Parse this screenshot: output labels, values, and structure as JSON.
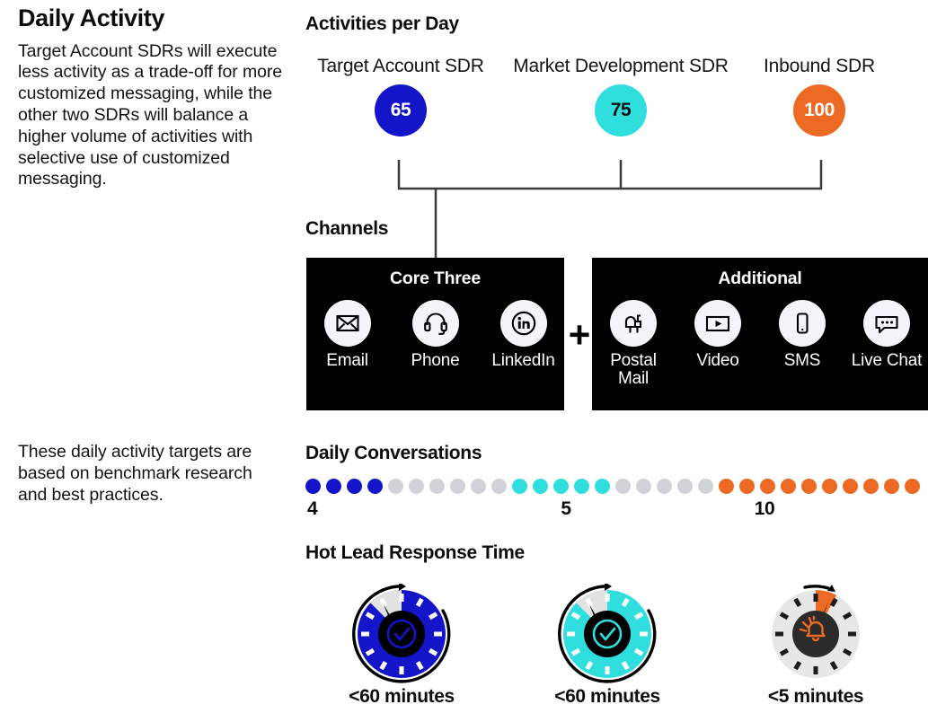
{
  "colors": {
    "blue": "#1414c8",
    "cyan": "#2fdedd",
    "orange": "#ec6a24",
    "gray_dot": "#cfd2d6",
    "black": "#000000",
    "white": "#ffffff",
    "hub_dark": "#1c1c1c",
    "gray_wedge": "#e2e2e2",
    "ring_gray": "#e7e7e7"
  },
  "left": {
    "title": "Daily Activity",
    "lede": "Target Account SDRs will execute less activity as a trade-off for more customized messaging, while the other two SDRs will balance a higher volume of activities with selective use of customized messaging.",
    "note": "These daily activity targets are based on benchmark research and best practices."
  },
  "activities": {
    "heading": "Activities per Day",
    "columns": [
      {
        "name": "Target Account SDR",
        "value": "65",
        "color": "#1414c8",
        "text_color": "#ffffff"
      },
      {
        "name": "Market Development SDR",
        "value": "75",
        "color": "#2fdedd",
        "text_color": "#111111"
      },
      {
        "name": "Inbound SDR",
        "value": "100",
        "color": "#ec6a24",
        "text_color": "#ffffff"
      }
    ]
  },
  "channels": {
    "heading": "Channels",
    "plus": "+",
    "core": {
      "title": "Core Three",
      "items": [
        {
          "label": "Email",
          "icon": "envelope-icon"
        },
        {
          "label": "Phone",
          "icon": "headset-icon"
        },
        {
          "label": "LinkedIn",
          "icon": "linkedin-icon"
        }
      ]
    },
    "additional": {
      "title": "Additional",
      "items": [
        {
          "label": "Postal Mail",
          "icon": "mailbox-icon"
        },
        {
          "label": "Video",
          "icon": "video-play-icon"
        },
        {
          "label": "SMS",
          "icon": "mobile-phone-icon"
        },
        {
          "label": "Live Chat",
          "icon": "chat-bubble-icon"
        }
      ]
    }
  },
  "conversations": {
    "heading": "Daily Conversations",
    "groups": [
      {
        "label": "4",
        "filled": 4,
        "total": 10,
        "color": "#1414c8"
      },
      {
        "label": "5",
        "filled": 5,
        "total": 10,
        "color": "#2fdedd"
      },
      {
        "label": "10",
        "filled": 10,
        "total": 10,
        "color": "#ec6a24"
      }
    ]
  },
  "hot_lead": {
    "heading": "Hot Lead Response Time",
    "clocks": [
      {
        "label": "<60 minutes",
        "color": "#1414c8",
        "center_icon": "check-circle-icon",
        "fill_mode": "mostly-filled"
      },
      {
        "label": "<60 minutes",
        "color": "#2fdedd",
        "center_icon": "check-circle-icon",
        "fill_mode": "mostly-filled"
      },
      {
        "label": "<5 minutes",
        "color": "#ec6a24",
        "center_icon": "alarm-bell-icon",
        "fill_mode": "small-slice"
      }
    ]
  },
  "chart_data": {
    "type": "bar",
    "title": "Daily Activity targets by SDR role",
    "categories": [
      "Target Account SDR",
      "Market Development SDR",
      "Inbound SDR"
    ],
    "series": [
      {
        "name": "Activities per Day",
        "values": [
          65,
          75,
          100
        ]
      },
      {
        "name": "Daily Conversations",
        "values": [
          4,
          5,
          10
        ]
      },
      {
        "name": "Hot Lead Response Time (minutes, max)",
        "values": [
          60,
          60,
          5
        ]
      }
    ],
    "xlabel": "",
    "ylabel": "",
    "grid": false,
    "legend": "none"
  }
}
